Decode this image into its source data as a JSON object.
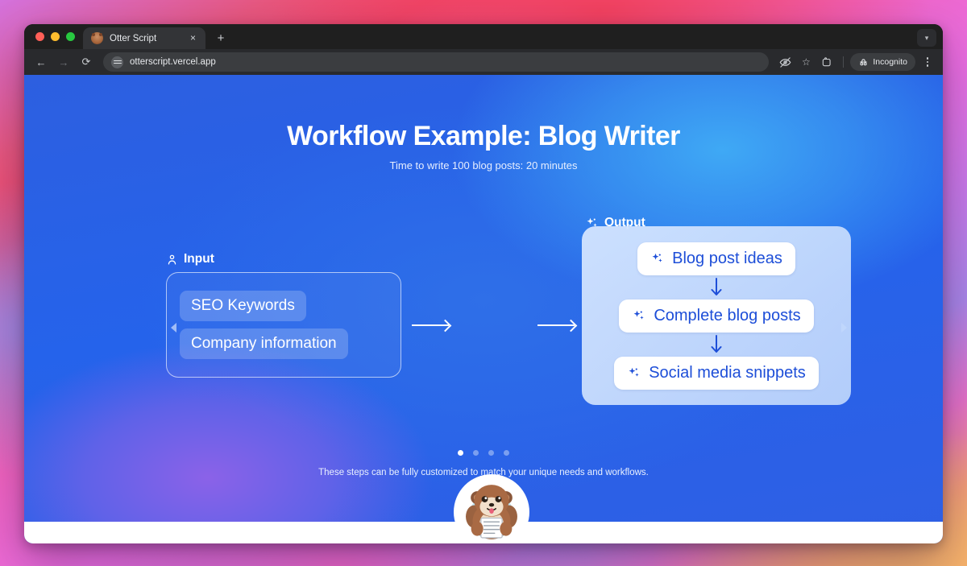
{
  "browser": {
    "tab": {
      "title": "Otter Script",
      "favicon_icon": "otter-favicon",
      "close_label": "×"
    },
    "new_tab_label": "+",
    "tabstrip_menu_icon": "chevron-down-icon",
    "toolbar": {
      "back_icon": "←",
      "forward_icon": "→",
      "reload_icon": "⟳",
      "site_settings_icon": "tune-icon",
      "url": "otterscript.vercel.app",
      "tracking_protection_icon": "eye-slash-icon",
      "bookmark_icon": "☆",
      "extensions_icon": "⧉",
      "incognito_label": "Incognito",
      "incognito_icon": "incognito-hat-icon",
      "menu_icon": "three-dots-icon"
    }
  },
  "page": {
    "hero": {
      "title": "Workflow Example: Blog Writer",
      "subtitle": "Time to write 100 blog posts: 20 minutes"
    },
    "input": {
      "label": "Input",
      "icon": "person-icon",
      "items": [
        {
          "label": "SEO Keywords"
        },
        {
          "label": "Company information"
        }
      ]
    },
    "agent": {
      "icon": "otter-avatar-icon"
    },
    "output": {
      "label": "Output",
      "icon": "sparkle-icon",
      "items": [
        {
          "label": "Blog post ideas",
          "icon": "sparkle-icon"
        },
        {
          "label": "Complete blog posts",
          "icon": "sparkle-icon"
        },
        {
          "label": "Social media snippets",
          "icon": "sparkle-icon"
        }
      ]
    },
    "carousel": {
      "prev_icon": "chevron-left-icon",
      "next_icon": "chevron-right-icon",
      "dot_count": 4,
      "active_index": 0
    },
    "caption": "These steps can be fully customized to match your unique needs and workflows.",
    "colors": {
      "page_blue": "#2563eb",
      "accent_cyan": "#3fa9f5",
      "accent_purple": "#8b62e8",
      "output_text": "#1d4ed8",
      "output_panel": "#d4e5ff"
    }
  }
}
